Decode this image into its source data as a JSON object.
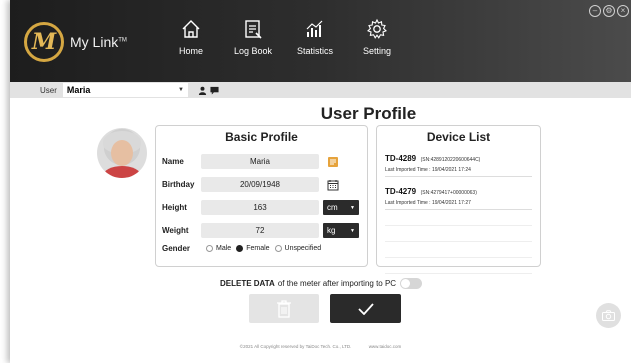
{
  "app": {
    "logo_text": "My Link",
    "logo_tm": "TM"
  },
  "nav": [
    {
      "label": "Home",
      "icon": "home-icon"
    },
    {
      "label": "Log Book",
      "icon": "logbook-icon"
    },
    {
      "label": "Statistics",
      "icon": "statistics-icon"
    },
    {
      "label": "Setting",
      "icon": "gear-icon"
    }
  ],
  "user_bar": {
    "label": "User",
    "selected_user": "Maria"
  },
  "page_title": "User Profile",
  "basic_profile": {
    "title": "Basic Profile",
    "name_label": "Name",
    "name_value": "Maria",
    "birthday_label": "Birthday",
    "birthday_value": "20/09/1948",
    "height_label": "Height",
    "height_value": "163",
    "height_unit": "cm",
    "weight_label": "Weight",
    "weight_value": "72",
    "weight_unit": "kg",
    "gender_label": "Gender",
    "gender_options": [
      "Male",
      "Female",
      "Unspecified"
    ],
    "gender_selected": "Female"
  },
  "device_list": {
    "title": "Device List",
    "devices": [
      {
        "id": "TD-4289",
        "sn": "(SN:4289120220600644C)",
        "time": "Last Imported Time : 19/04/2021 17:24"
      },
      {
        "id": "TD-4279",
        "sn": "(SN:4279417+00000063)",
        "time": "Last Imported Time : 19/04/2021 17:27"
      }
    ]
  },
  "delete_option": {
    "bold": "DELETE DATA",
    "rest": "of the meter after importing to PC",
    "enabled": false
  },
  "footer": {
    "copyright": "©2021 All Copyright reserved by TaiDoc Tech. Co., LTD.",
    "website": "www.taidoc.com"
  },
  "colors": {
    "topbar": "#2e2e2e",
    "logo_gold": "#d5a742",
    "confirm": "#2a2a2a"
  }
}
